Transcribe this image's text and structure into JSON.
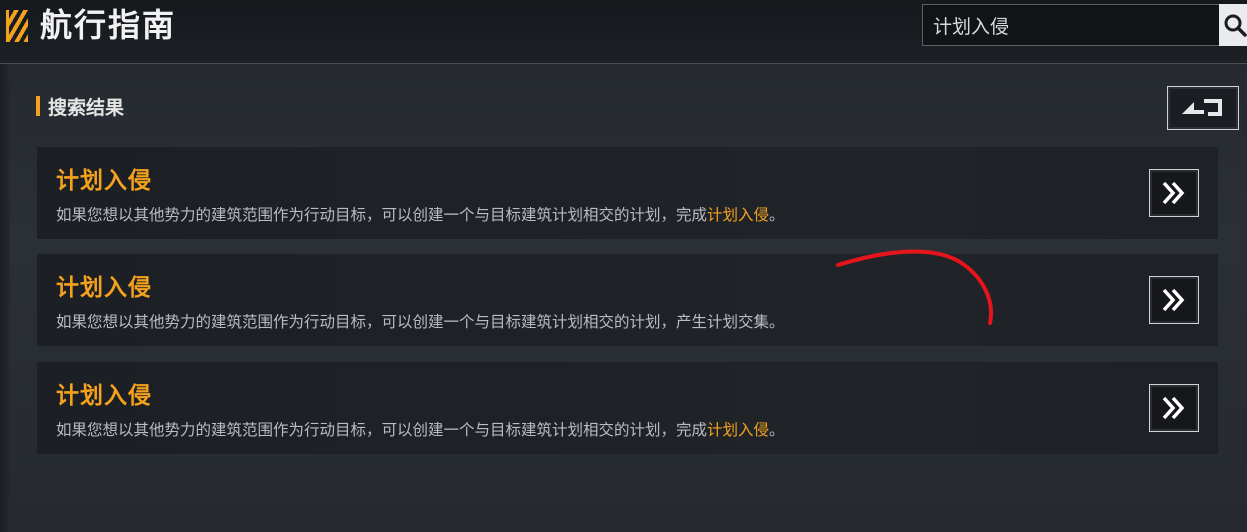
{
  "header": {
    "title": "航行指南",
    "search_value": "计划入侵"
  },
  "section": {
    "title": "搜索结果"
  },
  "results": [
    {
      "title": "计划入侵",
      "desc_prefix": "如果您想以其他势力的建筑范围作为行动目标，可以创建一个与目标建筑计划相交的计划，完成",
      "desc_highlight": "计划入侵",
      "desc_suffix": "。"
    },
    {
      "title": "计划入侵",
      "desc_prefix": "如果您想以其他势力的建筑范围作为行动目标，可以创建一个与目标建筑计划相交的计划，产生计划交集。",
      "desc_highlight": "",
      "desc_suffix": ""
    },
    {
      "title": "计划入侵",
      "desc_prefix": "如果您想以其他势力的建筑范围作为行动目标，可以创建一个与目标建筑计划相交的计划，完成",
      "desc_highlight": "计划入侵",
      "desc_suffix": "。"
    }
  ],
  "icons": {
    "logo": "striped-logo-icon",
    "search": "search-icon",
    "back": "back-arrow-icon",
    "go": "double-chevron-right-icon"
  },
  "colors": {
    "accent": "#f4a21d",
    "annotation": "#e8141c"
  }
}
